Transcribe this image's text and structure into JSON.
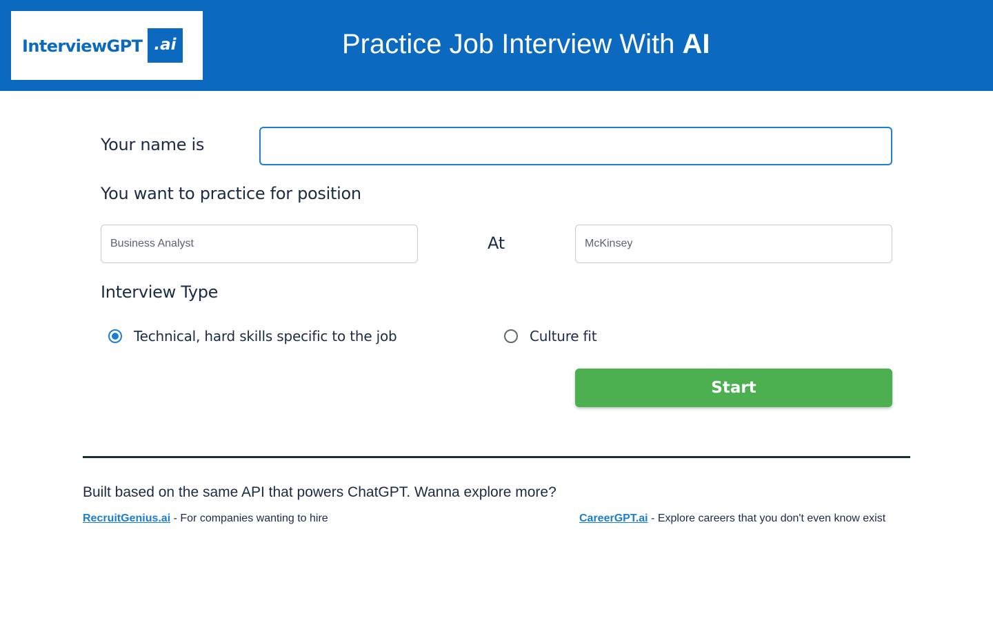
{
  "header": {
    "logo_text": "InterviewGPT",
    "logo_badge": ".ai",
    "title_prefix": "Practice Job Interview With ",
    "title_emphasis": "AI"
  },
  "form": {
    "name_label": "Your name is",
    "name_value": "",
    "position_heading": "You want to practice for position",
    "position_placeholder": "Business Analyst",
    "at_label": "At",
    "company_placeholder": "McKinsey",
    "interview_type_heading": "Interview Type",
    "interview_types": [
      {
        "label": "Technical, hard skills specific to the job",
        "checked": true
      },
      {
        "label": "Culture fit",
        "checked": false
      }
    ],
    "start_label": "Start"
  },
  "footer": {
    "title": "Built based on the same API that powers ChatGPT. Wanna explore more?",
    "links": [
      {
        "text": "RecruitGenius.ai",
        "description": " - For companies wanting to hire"
      },
      {
        "text": "CareerGPT.ai",
        "description": " - Explore careers that you don't even know exist"
      }
    ]
  },
  "colors": {
    "header_bg": "#0b6abf",
    "accent": "#1a7fd4",
    "start_button": "#4caf50",
    "text": "#1c2b45"
  }
}
